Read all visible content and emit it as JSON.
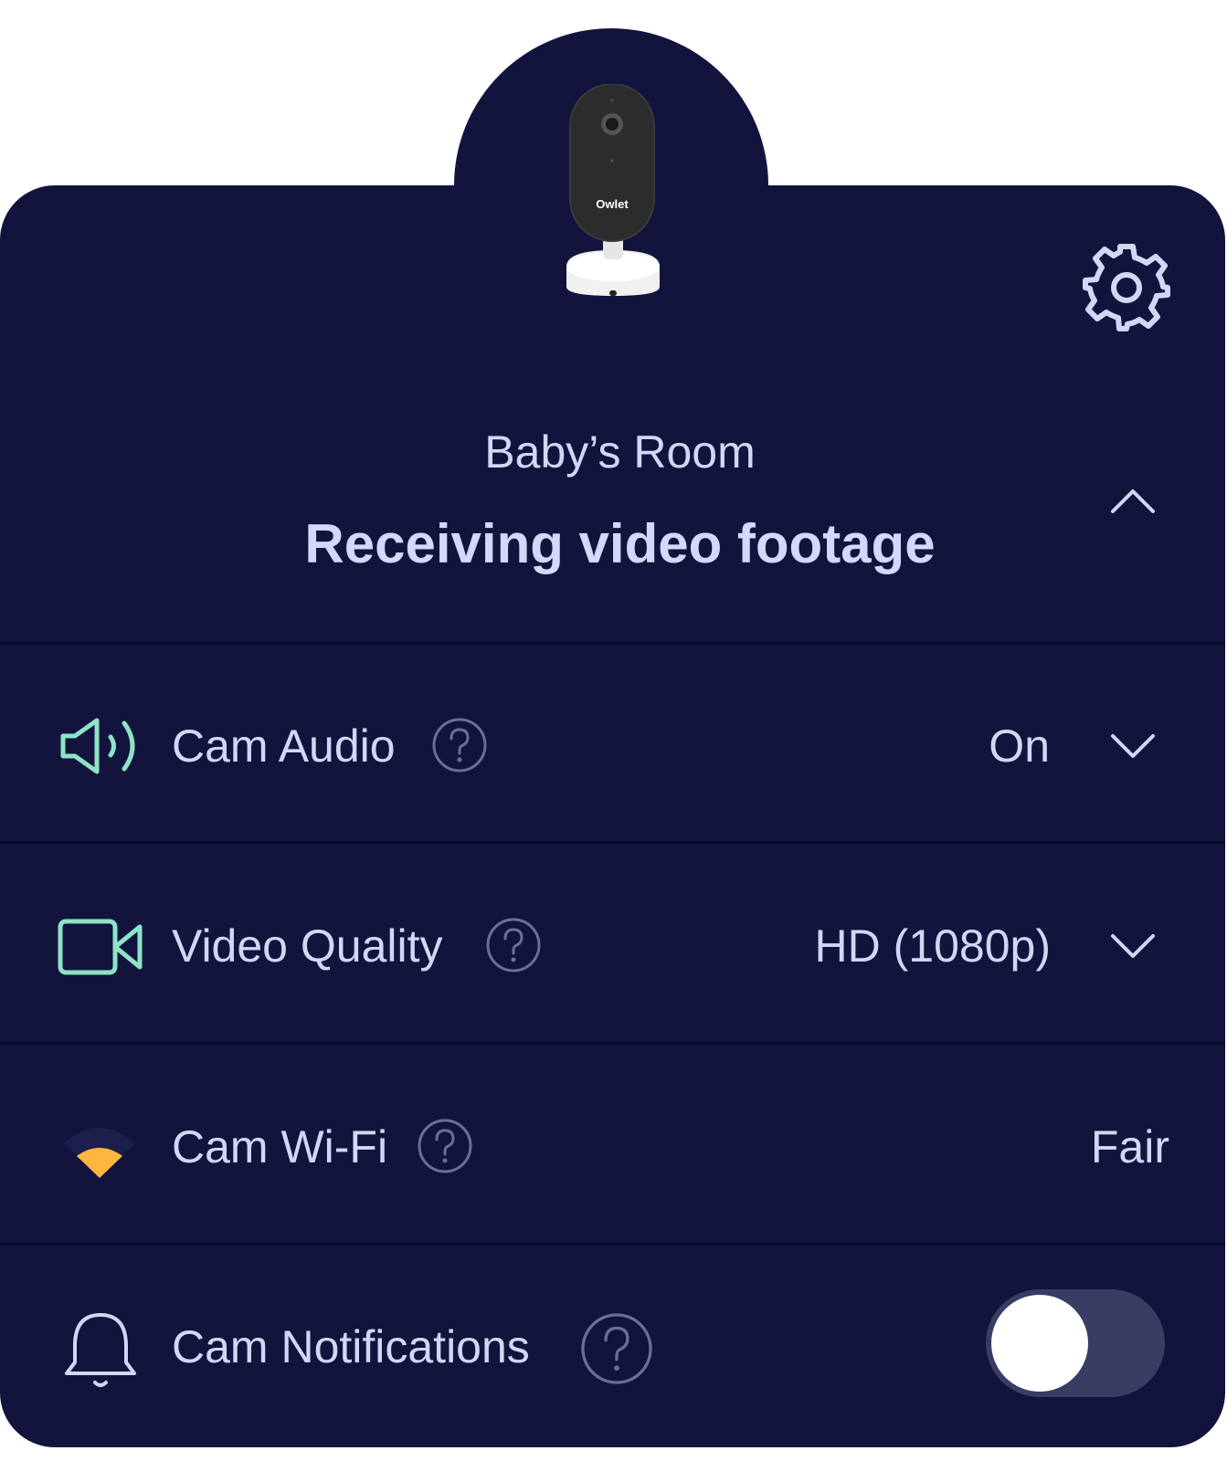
{
  "header": {
    "room_name": "Baby’s Room",
    "status": "Receiving video footage",
    "camera_brand": "Owlet"
  },
  "rows": [
    {
      "label": "Cam Audio",
      "value": "On",
      "icon": "speaker-icon",
      "control": "dropdown"
    },
    {
      "label": "Video Quality",
      "value": "HD (1080p)",
      "icon": "video-camera-icon",
      "control": "dropdown"
    },
    {
      "label": "Cam Wi-Fi",
      "value": "Fair",
      "icon": "wifi-icon",
      "control": "none"
    },
    {
      "label": "Cam Notifications",
      "value": "",
      "icon": "bell-icon",
      "control": "toggle",
      "toggle_on": false
    }
  ],
  "colors": {
    "background": "#12143e",
    "text": "#d4d6f4",
    "accent_mint": "#8ee3c6",
    "wifi_fair": "#ffb640",
    "toggle_track": "#3a3c63",
    "help_icon": "#6c6e9a"
  }
}
